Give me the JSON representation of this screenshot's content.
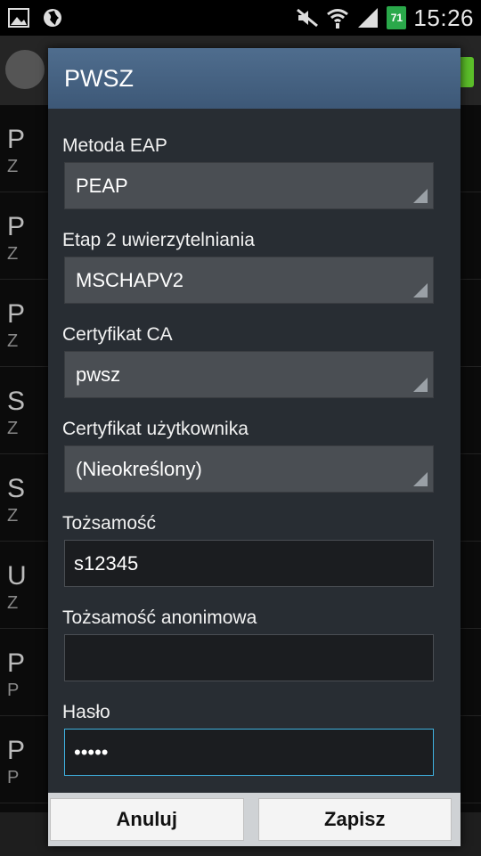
{
  "status_bar": {
    "battery": "71",
    "time": "15:26",
    "icons": [
      "image-icon",
      "globe-icon",
      "mute-icon",
      "wifi-icon",
      "signal-icon"
    ]
  },
  "dialog": {
    "title": "PWSZ",
    "fields": {
      "eap_method": {
        "label": "Metoda EAP",
        "value": "PEAP"
      },
      "phase2": {
        "label": "Etap 2 uwierzytelniania",
        "value": "MSCHAPV2"
      },
      "ca_cert": {
        "label": "Certyfikat CA",
        "value": "pwsz"
      },
      "user_cert": {
        "label": "Certyfikat użytkownika",
        "value": "(Nieokreślony)"
      },
      "identity": {
        "label": "Tożsamość",
        "value": "s12345"
      },
      "anon_identity": {
        "label": "Tożsamość anonimowa",
        "value": ""
      },
      "password": {
        "label": "Hasło",
        "value": "•••••"
      }
    },
    "buttons": {
      "cancel": "Anuluj",
      "save": "Zapisz"
    }
  },
  "background": {
    "row_letters": [
      "P",
      "P",
      "P",
      "S",
      "S",
      "U",
      "P",
      "P"
    ],
    "row_sub": [
      "Z",
      "Z",
      "Z",
      "Z",
      "Z",
      "Z",
      "P",
      "P"
    ]
  },
  "colors": {
    "title_bar": "#46627f",
    "focus_border": "#3fb1e0",
    "battery": "#2aa84a"
  }
}
